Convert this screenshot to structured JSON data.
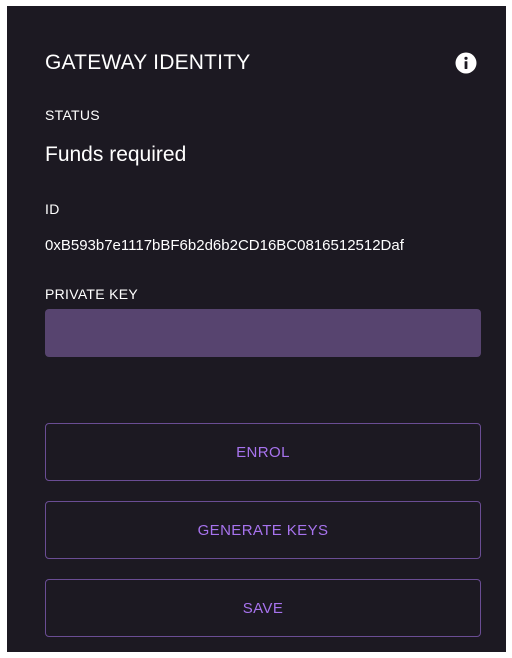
{
  "panel": {
    "title": "GATEWAY IDENTITY",
    "info_icon": "info-circle-icon",
    "status": {
      "label": "STATUS",
      "value": "Funds required"
    },
    "id": {
      "label": "ID",
      "value": "0xB593b7e1117bBF6b2d6b2CD16BC0816512512Daf"
    },
    "private_key": {
      "label": "PRIVATE KEY",
      "value": "",
      "placeholder": ""
    },
    "buttons": {
      "enrol": "ENROL",
      "generate_keys": "GENERATE KEYS",
      "save": "SAVE"
    }
  },
  "colors": {
    "panel_background": "#1c1922",
    "input_background": "#57446f",
    "button_border": "#6a4d94",
    "button_text": "#a773ee"
  }
}
